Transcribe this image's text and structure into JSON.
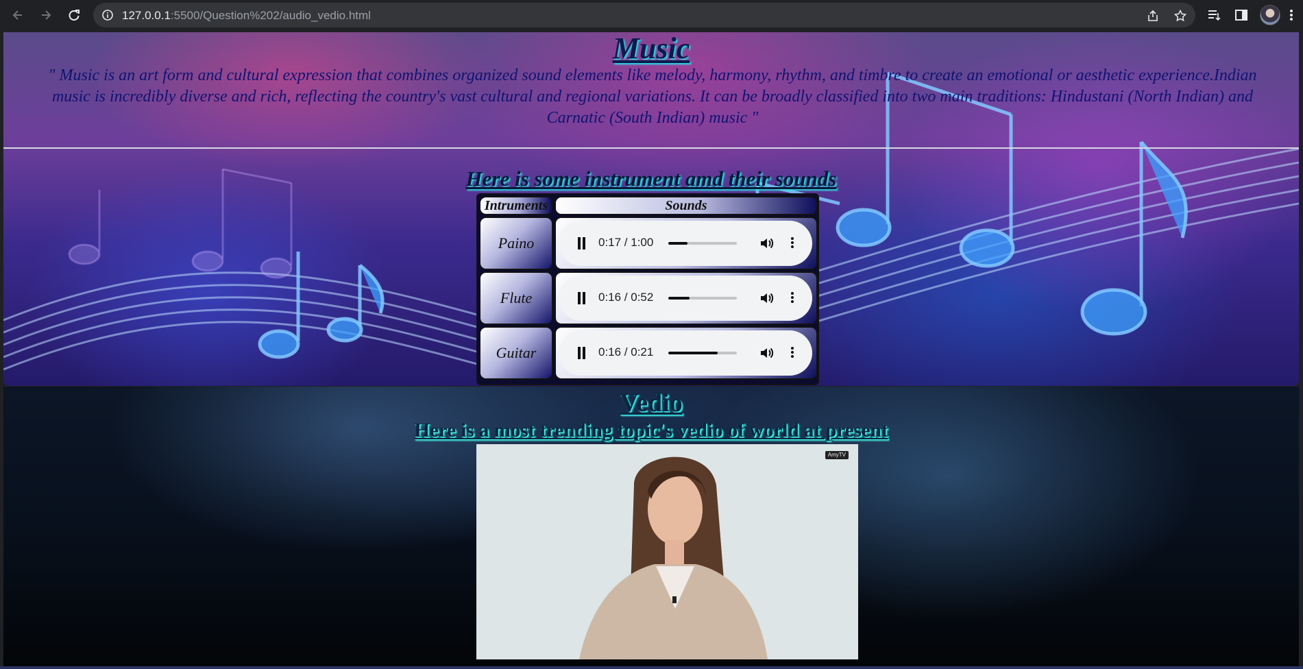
{
  "browser": {
    "url_host": "127.0.0.1",
    "url_rest": ":5500/Question%202/audio_vedio.html"
  },
  "music": {
    "title": "Music",
    "quote": "\" Music is an art form and cultural expression that combines organized sound elements like melody, harmony, rhythm, and timbre to create an emotional or aesthetic experience.Indian music is incredibly diverse and rich, reflecting the country's vast cultural and regional variations. It can be broadly classified into two main traditions: Hindustani (North Indian) and Carnatic (South Indian) music \"",
    "subtitle": "Here is some instrument amd their sounds",
    "table": {
      "col_instruments": "Intruments",
      "col_sounds": "Sounds",
      "rows": [
        {
          "instrument": "Paino",
          "time": "0:17 / 1:00",
          "progress": 0.28
        },
        {
          "instrument": "Flute",
          "time": "0:16 / 0:52",
          "progress": 0.31
        },
        {
          "instrument": "Guitar",
          "time": "0:16 / 0:21",
          "progress": 0.72
        }
      ]
    }
  },
  "vedio": {
    "title": "Vedio",
    "subtitle": "Here is a most trending topic's vedio of world at present",
    "watermark": "AmyTV"
  },
  "colors": {
    "title_shadow": "#22e0f0",
    "quote_text": "#0f1470",
    "vedio_title_glow": "#3ff2ee"
  },
  "icons": [
    "back-arrow-icon",
    "forward-arrow-icon",
    "reload-icon",
    "info-icon",
    "share-icon",
    "star-icon",
    "reading-list-icon",
    "sidebar-icon",
    "menu-dots-icon",
    "pause-icon",
    "volume-icon",
    "more-options-icon"
  ]
}
